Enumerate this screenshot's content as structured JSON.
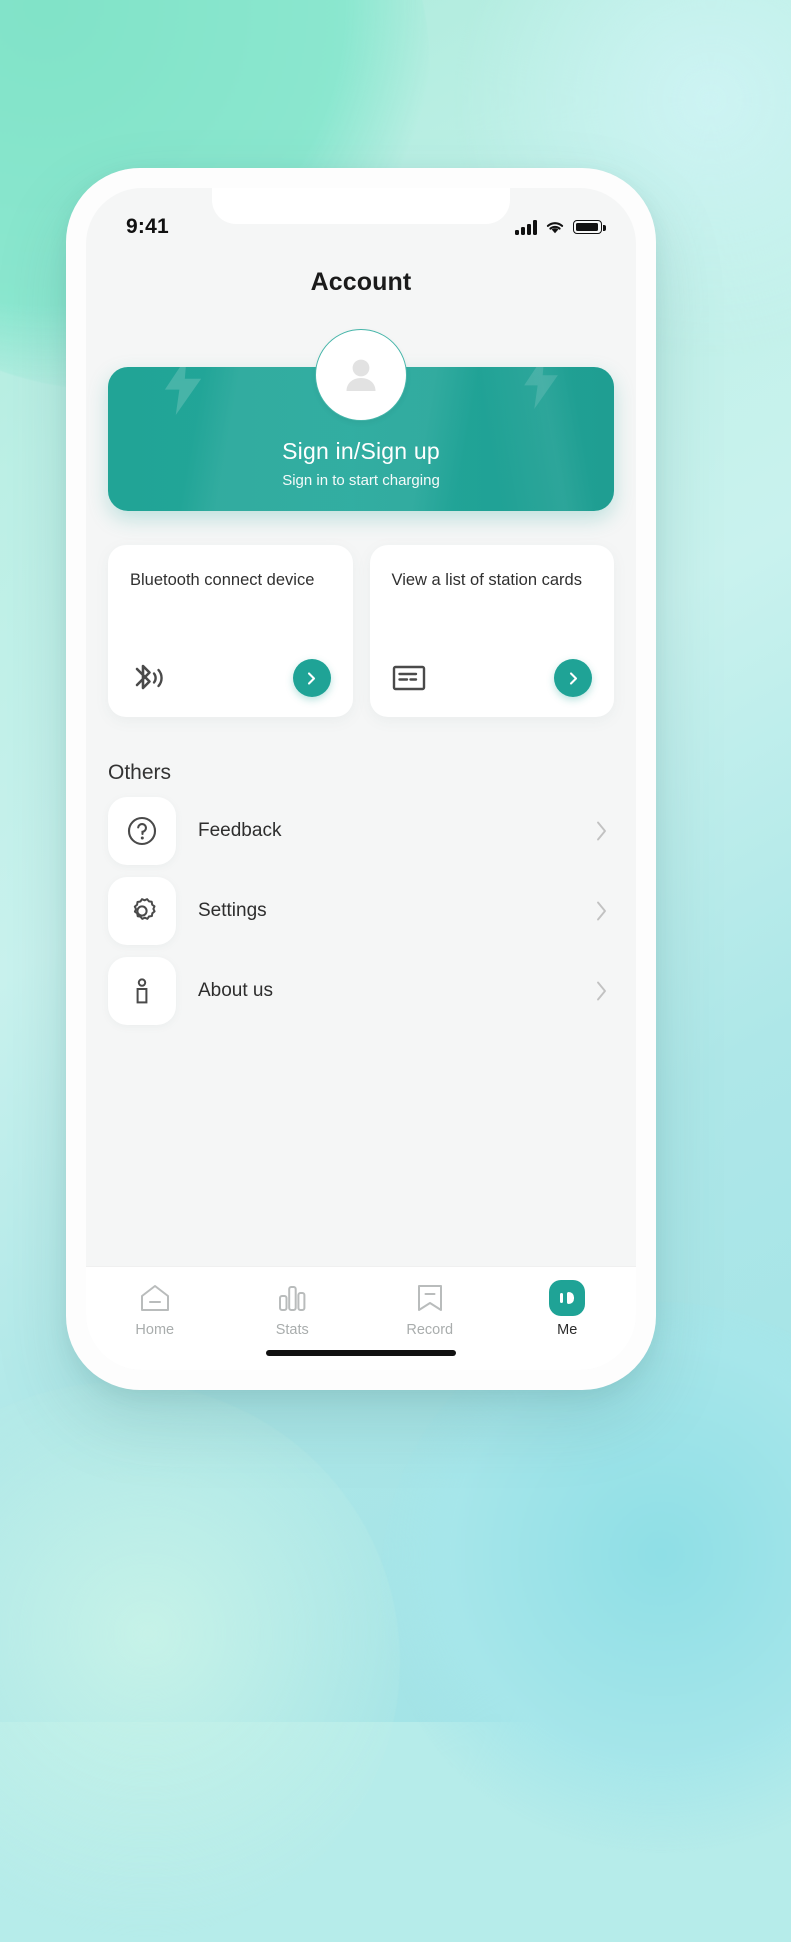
{
  "theme": {
    "accent": "#1fa396",
    "banner_gradient_start": "#21a496",
    "banner_gradient_end": "#1f9e92",
    "screen_bg": "#f5f6f6",
    "card_bg": "#ffffff",
    "page_bg_start": "#a8e9d8",
    "page_bg_end": "#9fe2e6"
  },
  "status_bar": {
    "time": "9:41",
    "signal_icon": "cellular-signal-icon",
    "wifi_icon": "wifi-icon",
    "battery_icon": "battery-icon"
  },
  "header": {
    "title": "Account"
  },
  "hero": {
    "avatar_icon": "user-avatar-icon",
    "title": "Sign in/Sign up",
    "subtitle": "Sign in to start charging"
  },
  "feature_cards": [
    {
      "title": "Bluetooth connect device",
      "icon": "bluetooth-audio-icon",
      "action_icon": "chevron-right-icon"
    },
    {
      "title": "View a list of station cards",
      "icon": "station-card-icon",
      "action_icon": "chevron-right-icon"
    }
  ],
  "others": {
    "section_title": "Others",
    "items": [
      {
        "label": "Feedback",
        "icon": "question-mark-circle-icon",
        "chevron": "chevron-right-icon"
      },
      {
        "label": "Settings",
        "icon": "gear-icon",
        "chevron": "chevron-right-icon"
      },
      {
        "label": "About us",
        "icon": "info-person-icon",
        "chevron": "chevron-right-icon"
      }
    ]
  },
  "tabbar": {
    "items": [
      {
        "label": "Home",
        "icon": "home-icon",
        "active": false
      },
      {
        "label": "Stats",
        "icon": "bar-chart-icon",
        "active": false
      },
      {
        "label": "Record",
        "icon": "bookmark-icon",
        "active": false
      },
      {
        "label": "Me",
        "icon": "me-face-icon",
        "active": true
      }
    ]
  }
}
